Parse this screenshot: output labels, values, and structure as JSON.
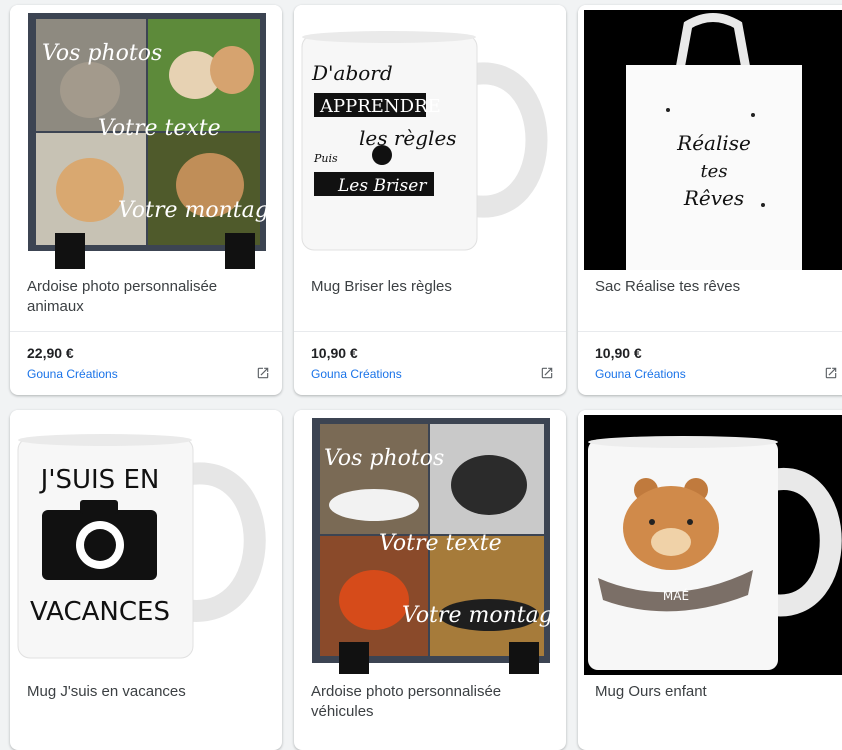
{
  "products": [
    {
      "title": "Ardoise photo personnalisée animaux",
      "price": "22,90 €",
      "seller": "Gouna Créations",
      "image_text": {
        "l1": "Vos photos",
        "l2": "Votre texte",
        "l3": "Votre montage"
      }
    },
    {
      "title": "Mug Briser les règles",
      "price": "10,90 €",
      "seller": "Gouna Créations",
      "image_text": {
        "l1": "D'abord",
        "l2": "APPRENDRE",
        "l3": "les règles",
        "l4": "Puis",
        "l5": "Les Briser"
      }
    },
    {
      "title": "Sac Réalise tes rêves",
      "price": "10,90 €",
      "seller": "Gouna Créations",
      "image_text": {
        "l1": "Réalise",
        "l2": "tes",
        "l3": "Rêves"
      }
    },
    {
      "title": "Mug J'suis en vacances",
      "image_text": {
        "l1": "J'SUIS EN",
        "l2": "VACANCES"
      }
    },
    {
      "title": "Ardoise photo personnalisée véhicules",
      "image_text": {
        "l1": "Vos photos",
        "l2": "Votre texte",
        "l3": "Votre montage"
      }
    },
    {
      "title": "Mug Ours enfant",
      "image_text": {
        "l1": "MAÉ"
      }
    }
  ],
  "icons": {
    "external_link": "external-link-icon"
  },
  "colors": {
    "seller_link": "#1a73e8",
    "price": "#202124",
    "title": "#3c4043"
  }
}
